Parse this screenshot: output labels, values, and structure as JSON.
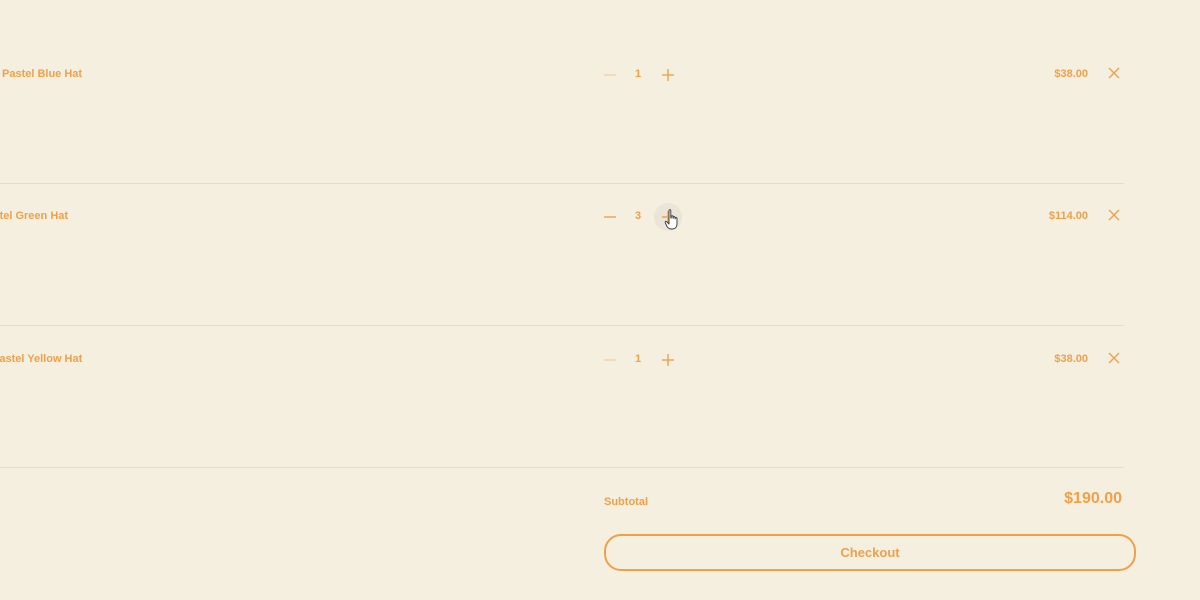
{
  "cart": {
    "items": [
      {
        "name": "Pastel Blue Hat",
        "quantity": "1",
        "price": "$38.00"
      },
      {
        "name": "Pastel Green Hat",
        "quantity": "3",
        "price": "$114.00"
      },
      {
        "name": "Pastel Yellow Hat",
        "quantity": "1",
        "price": "$38.00"
      }
    ],
    "subtotal_label": "Subtotal",
    "subtotal_value": "$190.00",
    "checkout_label": "Checkout"
  },
  "icons": {
    "decrement": "minus-icon",
    "increment": "plus-icon",
    "remove": "close-icon",
    "cursor": "hand-pointer-icon"
  },
  "colors": {
    "background": "#f5efdf",
    "accent": "#f0a04b",
    "divider": "#e3ddcc"
  }
}
